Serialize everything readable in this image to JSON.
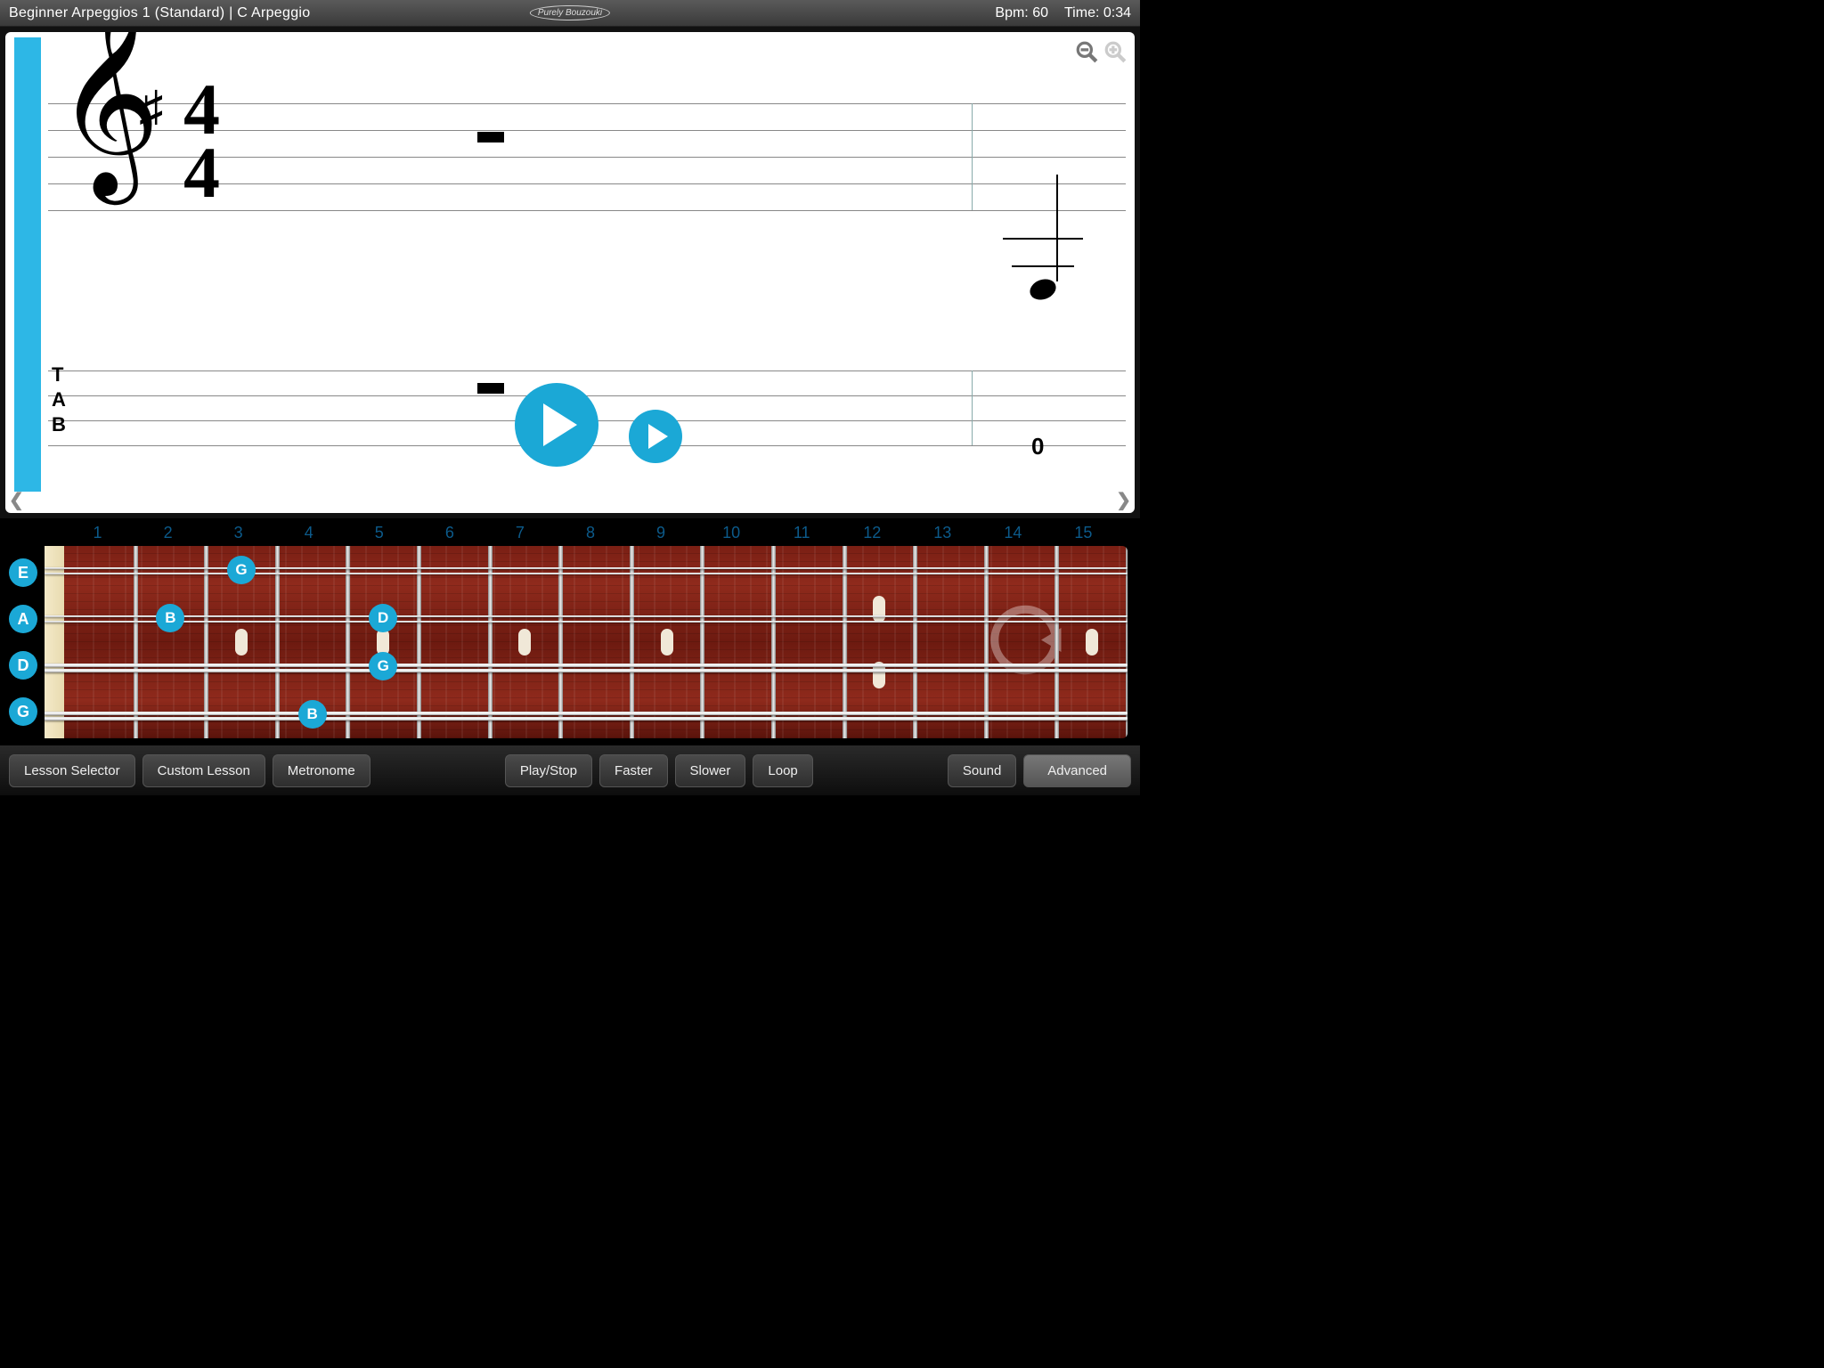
{
  "header": {
    "title": "Beginner Arpeggios 1 (Standard)  |  C Arpeggio",
    "logo": "Purely Bouzouki",
    "bpm_label": "Bpm:",
    "bpm_value": "60",
    "time_label": "Time:",
    "time_value": "0:34"
  },
  "notation": {
    "timesig_top": "4",
    "timesig_bot": "4",
    "tab_t": "T",
    "tab_a": "A",
    "tab_b": "B",
    "tab_zero": "0"
  },
  "fretboard": {
    "fret_numbers": [
      "1",
      "2",
      "3",
      "4",
      "5",
      "6",
      "7",
      "8",
      "9",
      "10",
      "11",
      "12",
      "13",
      "14",
      "15"
    ],
    "open_strings": [
      "E",
      "A",
      "D",
      "G"
    ],
    "notes": [
      {
        "string": 0,
        "fret": 3,
        "label": "G"
      },
      {
        "string": 1,
        "fret": 2,
        "label": "B"
      },
      {
        "string": 1,
        "fret": 5,
        "label": "D"
      },
      {
        "string": 2,
        "fret": 5,
        "label": "G"
      },
      {
        "string": 3,
        "fret": 4,
        "label": "B"
      }
    ]
  },
  "toolbar": {
    "lesson": "Lesson Selector",
    "custom": "Custom Lesson",
    "metro": "Metronome",
    "play": "Play/Stop",
    "faster": "Faster",
    "slower": "Slower",
    "loop": "Loop",
    "sound": "Sound",
    "advanced": "Advanced"
  }
}
